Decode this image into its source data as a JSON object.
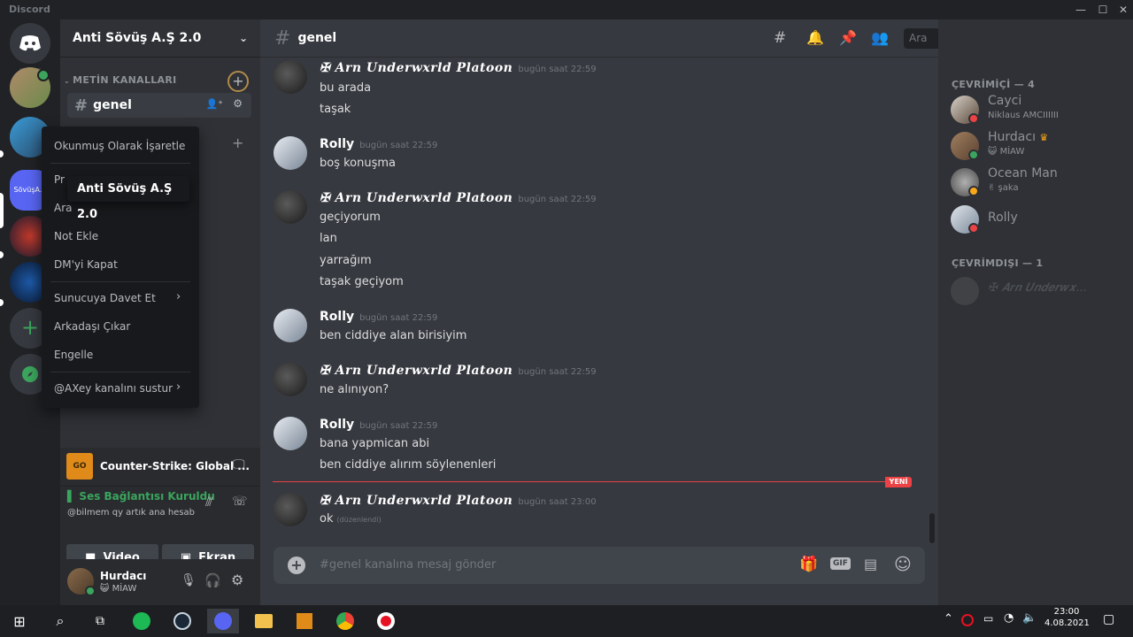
{
  "window": {
    "title": "Discord"
  },
  "server": {
    "name": "Anti Sövüş A.Ş 2.0"
  },
  "channels": {
    "category": "METİN KANALLARI",
    "active": "genel"
  },
  "context_menu": {
    "items": [
      "Okunmuş Olarak İşaretle",
      "Pr",
      "Ara",
      "Not Ekle",
      "DM'yi Kapat",
      "Sunucuya Davet Et",
      "Arkadaşı Çıkar",
      "Engelle",
      "@AXey kanalını sustur"
    ]
  },
  "tooltip": {
    "text": "Anti Sövüş A.Ş 2.0"
  },
  "activity": {
    "game": "Counter-Strike: Global ..."
  },
  "voice": {
    "status": "Ses Bağlantısı Kuruldu",
    "channel": "@bilmem qy artık ana hesab",
    "video": "Video",
    "screen": "Ekran"
  },
  "user": {
    "name": "Hurdacı",
    "status": "😺 MİAW"
  },
  "chat": {
    "channel": "genel",
    "search_placeholder": "Ara",
    "composer_placeholder": "#genel kanalına mesaj gönder",
    "new_label": "YENİ",
    "messages": [
      {
        "author": "✠ 𝑨𝒓𝒏 𝑼𝒏𝒅𝒆𝒓𝒘𝒙𝒓𝒍𝒅 𝑷𝒍𝒂𝒕𝒐𝒐𝒏",
        "time": "bugün saat 22:59",
        "lines": [
          "bu arada",
          "taşak"
        ]
      },
      {
        "author": "Rolly",
        "time": "bugün saat 22:59",
        "lines": [
          "boş konuşma"
        ]
      },
      {
        "author": "✠ 𝑨𝒓𝒏 𝑼𝒏𝒅𝒆𝒓𝒘𝒙𝒓𝒍𝒅 𝑷𝒍𝒂𝒕𝒐𝒐𝒏",
        "time": "bugün saat 22:59",
        "lines": [
          "geçiyorum",
          "lan",
          "yarrağım",
          "taşak geçiyom"
        ]
      },
      {
        "author": "Rolly",
        "time": "bugün saat 22:59",
        "lines": [
          "ben ciddiye alan birisiyim"
        ]
      },
      {
        "author": "✠ 𝑨𝒓𝒏 𝑼𝒏𝒅𝒆𝒓𝒘𝒙𝒓𝒍𝒅 𝑷𝒍𝒂𝒕𝒐𝒐𝒏",
        "time": "bugün saat 22:59",
        "lines": [
          "ne alınıyon?"
        ]
      },
      {
        "author": "Rolly",
        "time": "bugün saat 22:59",
        "lines": [
          "bana yapmican abi",
          "ben ciddiye alırım söylenenleri"
        ]
      },
      {
        "author": "✠ 𝑨𝒓𝒏 𝑼𝒏𝒅𝒆𝒓𝒘𝒙𝒓𝒍𝒅 𝑷𝒍𝒂𝒕𝒐𝒐𝒏",
        "time": "bugün saat 23:00",
        "lines": [
          "ok"
        ],
        "edited": "(düzenlendi)"
      }
    ]
  },
  "members": {
    "online_header": "ÇEVRİMİÇİ — 4",
    "offline_header": "ÇEVRİMDIŞI — 1",
    "online": [
      {
        "name": "Cayci",
        "status": "Niklaus AMCIIIIII"
      },
      {
        "name": "Hurdacı",
        "status": "😺 MİAW"
      },
      {
        "name": "Ocean Man",
        "status": "✌ şaka"
      },
      {
        "name": "Rolly",
        "status": ""
      }
    ],
    "offline": [
      {
        "name": "✠ 𝑨𝒓𝒏 𝑼𝒏𝒅𝒆𝒓𝒘𝒙..."
      }
    ]
  },
  "taskbar": {
    "time": "23:00",
    "date": "4.08.2021"
  },
  "colors": {
    "online": "#3ba55d",
    "dnd": "#ed4245",
    "idle": "#faa81a",
    "accent": "#5865f2",
    "green": "#3ba55d"
  }
}
